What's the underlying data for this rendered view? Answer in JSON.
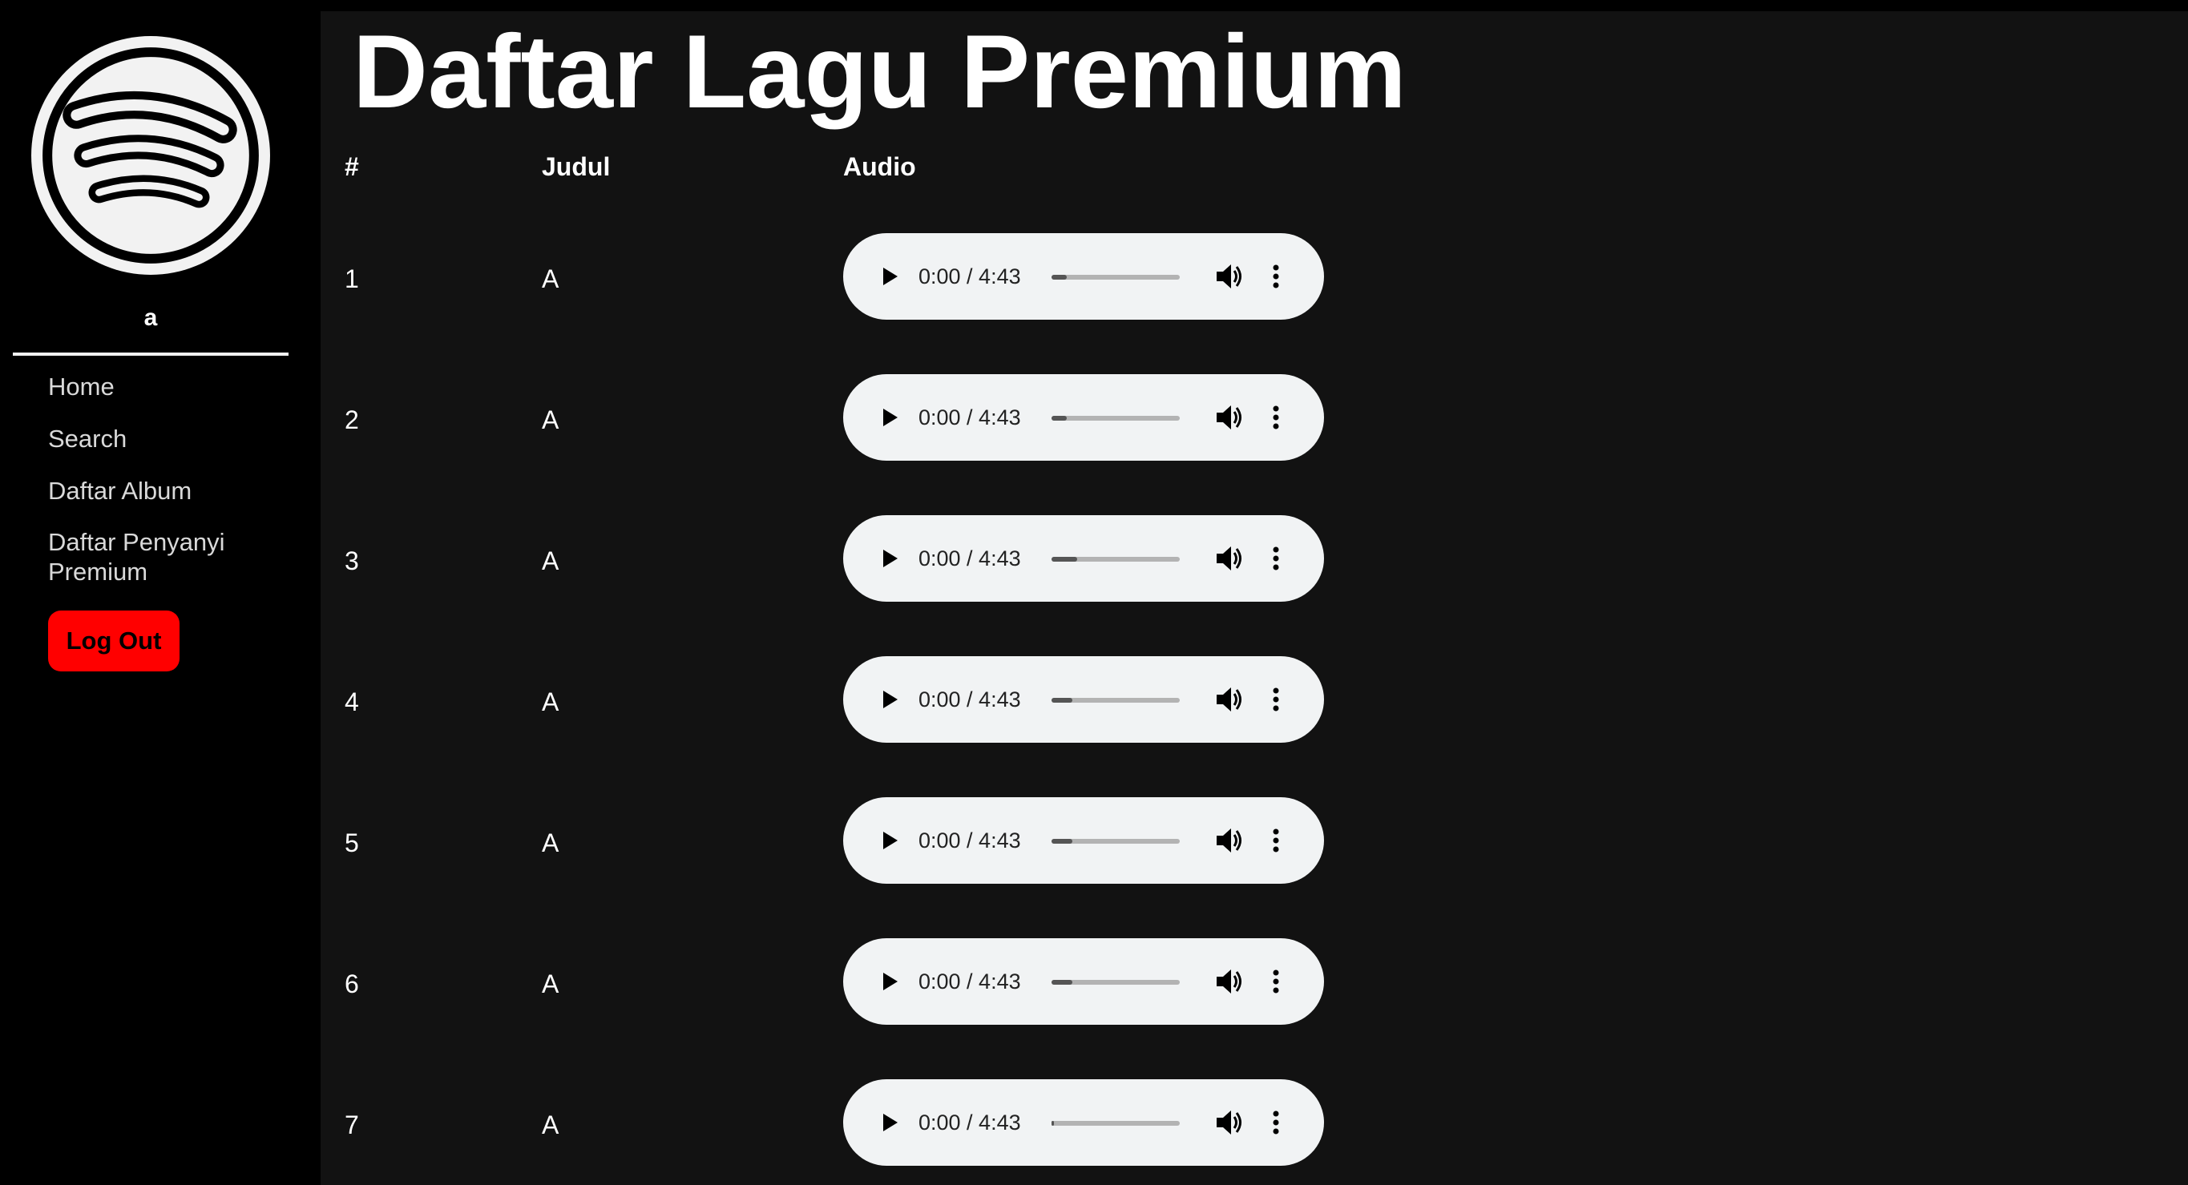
{
  "sidebar": {
    "username": "a",
    "nav": [
      "Home",
      "Search",
      "Daftar Album",
      "Daftar Penyanyi Premium"
    ],
    "logout_label": "Log Out",
    "logout_color": "#ff0000"
  },
  "main": {
    "title": "Daftar Lagu Premium",
    "columns": [
      "#",
      "Judul",
      "Audio"
    ],
    "rows": [
      {
        "num": "1",
        "title": "A",
        "time": "0:00 / 4:43",
        "progress": 0.12
      },
      {
        "num": "2",
        "title": "A",
        "time": "0:00 / 4:43",
        "progress": 0.12
      },
      {
        "num": "3",
        "title": "A",
        "time": "0:00 / 4:43",
        "progress": 0.2
      },
      {
        "num": "4",
        "title": "A",
        "time": "0:00 / 4:43",
        "progress": 0.16
      },
      {
        "num": "5",
        "title": "A",
        "time": "0:00 / 4:43",
        "progress": 0.16
      },
      {
        "num": "6",
        "title": "A",
        "time": "0:00 / 4:43",
        "progress": 0.16
      },
      {
        "num": "7",
        "title": "A",
        "time": "0:00 / 4:43",
        "progress": 0.02
      }
    ]
  },
  "icons": {
    "logo": "spotify-logo-icon",
    "play": "play-icon",
    "volume": "volume-icon",
    "more": "more-options-icon"
  }
}
